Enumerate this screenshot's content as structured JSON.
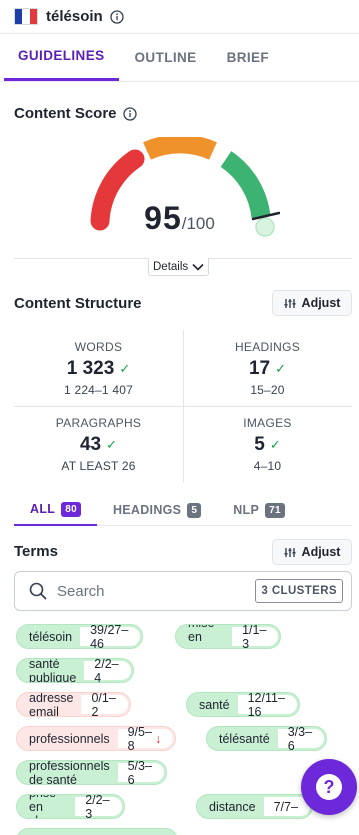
{
  "header": {
    "keyword": "télésoin",
    "icons": {
      "flag": "france-flag-icon",
      "info": "info-icon"
    }
  },
  "tabs": [
    {
      "label": "GUIDELINES",
      "active": true
    },
    {
      "label": "OUTLINE",
      "active": false
    },
    {
      "label": "BRIEF",
      "active": false
    }
  ],
  "content_score": {
    "title": "Content Score",
    "score": "95",
    "max": "/100",
    "details_label": "Details",
    "gauge_colors": [
      "#e5383b",
      "#f0922b",
      "#3cb371"
    ]
  },
  "structure": {
    "title": "Content Structure",
    "adjust_label": "Adjust",
    "stats": [
      {
        "label": "WORDS",
        "value": "1 323",
        "range": "1 224–1 407"
      },
      {
        "label": "HEADINGS",
        "value": "17",
        "range": "15–20"
      },
      {
        "label": "PARAGRAPHS",
        "value": "43",
        "range": "AT LEAST 26"
      },
      {
        "label": "IMAGES",
        "value": "5",
        "range": "4–10"
      }
    ]
  },
  "subtabs": [
    {
      "label": "ALL",
      "count": "80",
      "active": true
    },
    {
      "label": "HEADINGS",
      "count": "5",
      "active": false
    },
    {
      "label": "NLP",
      "count": "71",
      "active": false
    }
  ],
  "terms": {
    "title": "Terms",
    "adjust_label": "Adjust",
    "search_placeholder": "Search",
    "clusters_label": "3 CLUSTERS",
    "chips": [
      {
        "term": "télésoin",
        "count": "39/27–46",
        "status": "ok"
      },
      {
        "term": "mise en œuvre",
        "count": "1/1–3",
        "status": "ok"
      },
      {
        "term": "santé publique",
        "count": "2/2–4",
        "status": "ok"
      },
      {
        "term": "adresse email",
        "count": "0/1–2",
        "status": "missing"
      },
      {
        "term": "santé",
        "count": "12/11–16",
        "status": "ok"
      },
      {
        "term": "professionnels",
        "count": "9/5–8",
        "status": "over"
      },
      {
        "term": "télésanté",
        "count": "3/3–6",
        "status": "ok"
      },
      {
        "term": "professionnels de santé",
        "count": "5/3–6",
        "status": "ok"
      },
      {
        "term": "prise en charge",
        "count": "2/2–3",
        "status": "ok"
      },
      {
        "term": "distance",
        "count": "7/7–",
        "status": "ok"
      }
    ]
  },
  "help": {
    "label": "?"
  }
}
